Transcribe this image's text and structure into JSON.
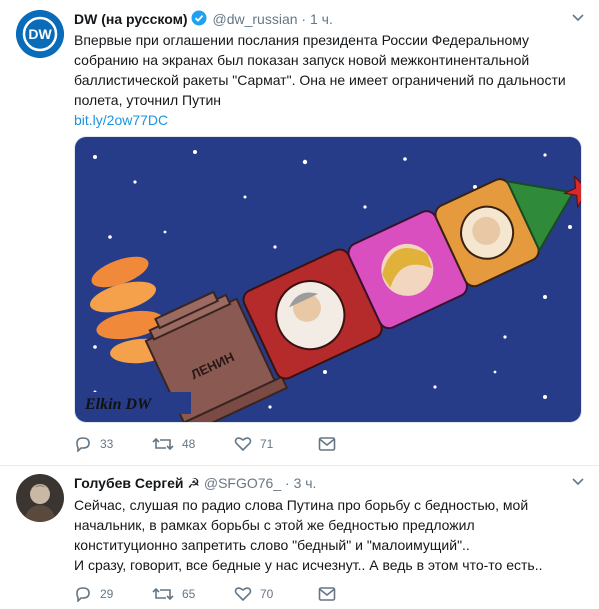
{
  "tweet1": {
    "name": "DW (на русском)",
    "handle": "@dw_russian",
    "dot": "·",
    "time": "1 ч.",
    "text_lines": [
      "Впервые при оглашении послания президента России Федеральному",
      "собранию на экранах был показан запуск новой межконтинентальной",
      "баллистической ракеты \"Сармат\". Она не имеет ограничений по дальности",
      "полета, уточнил Путин"
    ],
    "link": "bit.ly/2ow77DC",
    "media": {
      "rocket_label": "ЛЕНИН",
      "signature": "Elkin DW"
    },
    "actions": {
      "replies": "33",
      "retweets": "48",
      "likes": "71"
    }
  },
  "tweet2": {
    "name": "Голубев Сергей ☭",
    "handle": "@SFGO76_",
    "dot": "·",
    "time": "3 ч.",
    "text_lines": [
      "Сейчас, слушая по радио слова Путина про борьбу с бедностью, мой",
      "начальник, в рамках борьбы с этой же бедностью предложил",
      "конституционно запретить слово \"бедный\" и \"малоимущий\"..",
      "И сразу, говорит, все бедные у нас исчезнут.. А ведь в этом что-то есть.."
    ],
    "actions": {
      "replies": "29",
      "retweets": "65",
      "likes": "70"
    }
  },
  "icons": [
    "dw-logo-icon",
    "verified-icon",
    "chevron-down-icon",
    "reply-icon",
    "retweet-icon",
    "like-icon",
    "message-icon"
  ],
  "colors": {
    "link": "#1b95e0",
    "muted": "#657786",
    "verified": "#1da1f2",
    "dw_blue": "#0a6cb8",
    "night_sky": "#273c88"
  }
}
